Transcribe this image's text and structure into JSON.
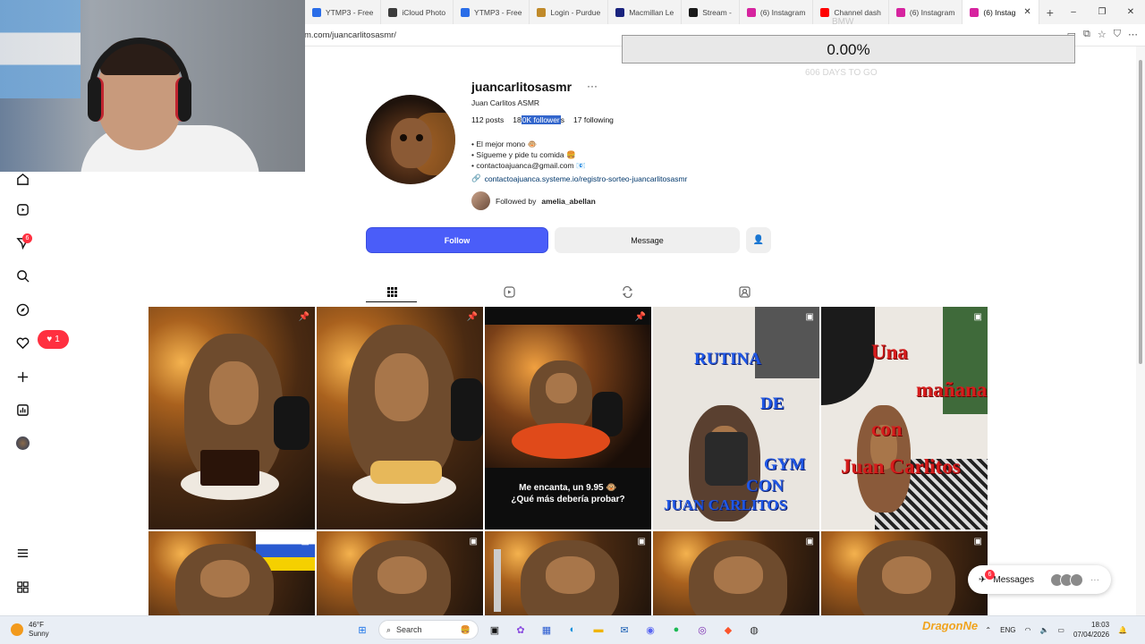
{
  "browser": {
    "tabs": [
      {
        "label": "YTMP3 - Free",
        "favicon": "#2a6de8"
      },
      {
        "label": "iCloud Photo",
        "favicon": "#3c3c3c"
      },
      {
        "label": "YTMP3 - Free",
        "favicon": "#2a6de8"
      },
      {
        "label": "Login - Purdue",
        "favicon": "#c08a2a"
      },
      {
        "label": "Macmillan Le",
        "favicon": "#1a237e"
      },
      {
        "label": "Stream - ",
        "favicon": "#1a1a1a"
      },
      {
        "label": "(6) Instagram",
        "favicon": "#d6249f"
      },
      {
        "label": "Channel dash",
        "favicon": "#ff0000"
      },
      {
        "label": "(6) Instagram",
        "favicon": "#d6249f"
      },
      {
        "label": "(6) Instag",
        "favicon": "#d6249f",
        "active": true
      }
    ],
    "new_tab": "+",
    "url": "m.com/juancarlitosasmr/",
    "window_controls": [
      "–",
      "❐",
      "✕"
    ]
  },
  "overlay": {
    "progress_label": "0.00%",
    "progress_value": 0.0,
    "days_label": "606 DAYS TO GO",
    "bmw_label": "BMW"
  },
  "nav": {
    "icons": [
      "home-icon",
      "reels-icon",
      "direct-icon",
      "search-icon",
      "explore-icon",
      "heart-icon",
      "create-icon",
      "dashboard-icon",
      "profile-icon",
      "menu-icon",
      "threads-icon"
    ],
    "direct_badge": "6",
    "notif_count": "1"
  },
  "profile": {
    "username": "juancarlitosasmr",
    "more": "···",
    "full_name": "Juan Carlitos ASMR",
    "posts": "112 posts",
    "followers_prefix": "18",
    "followers_selected": "0K follower",
    "followers_suffix": "s",
    "following": "17 following",
    "bio": [
      "• El mejor mono 🐵",
      "• Sígueme y pide tu comida 🍔",
      "• contactoajuanca@gmail.com 📧"
    ],
    "link": "contactoajuanca.systeme.io/registro-sorteo-juancarlitosasmr",
    "followed_by_prefix": "Followed by",
    "followed_by_user": "amelia_abellan",
    "follow_label": "Follow",
    "message_label": "Message"
  },
  "grid": {
    "captions": [
      "Me encanta, un 9.95 🐵\n¿Qué más debería probar?"
    ],
    "rutina_lines": [
      "RUTINA",
      "DE",
      "GYM",
      "CON",
      "JUAN CARLITOS"
    ],
    "manana_lines": [
      "Una",
      "mañana",
      "con",
      "Juan Carlitos"
    ]
  },
  "messages": {
    "label": "Messages",
    "badge": "6"
  },
  "taskbar": {
    "temp": "46°F",
    "weather": "Sunny",
    "search": "Search",
    "lang": "ENG",
    "time": "18:03",
    "date": "07/04/2026",
    "brand": "DragonNe"
  }
}
